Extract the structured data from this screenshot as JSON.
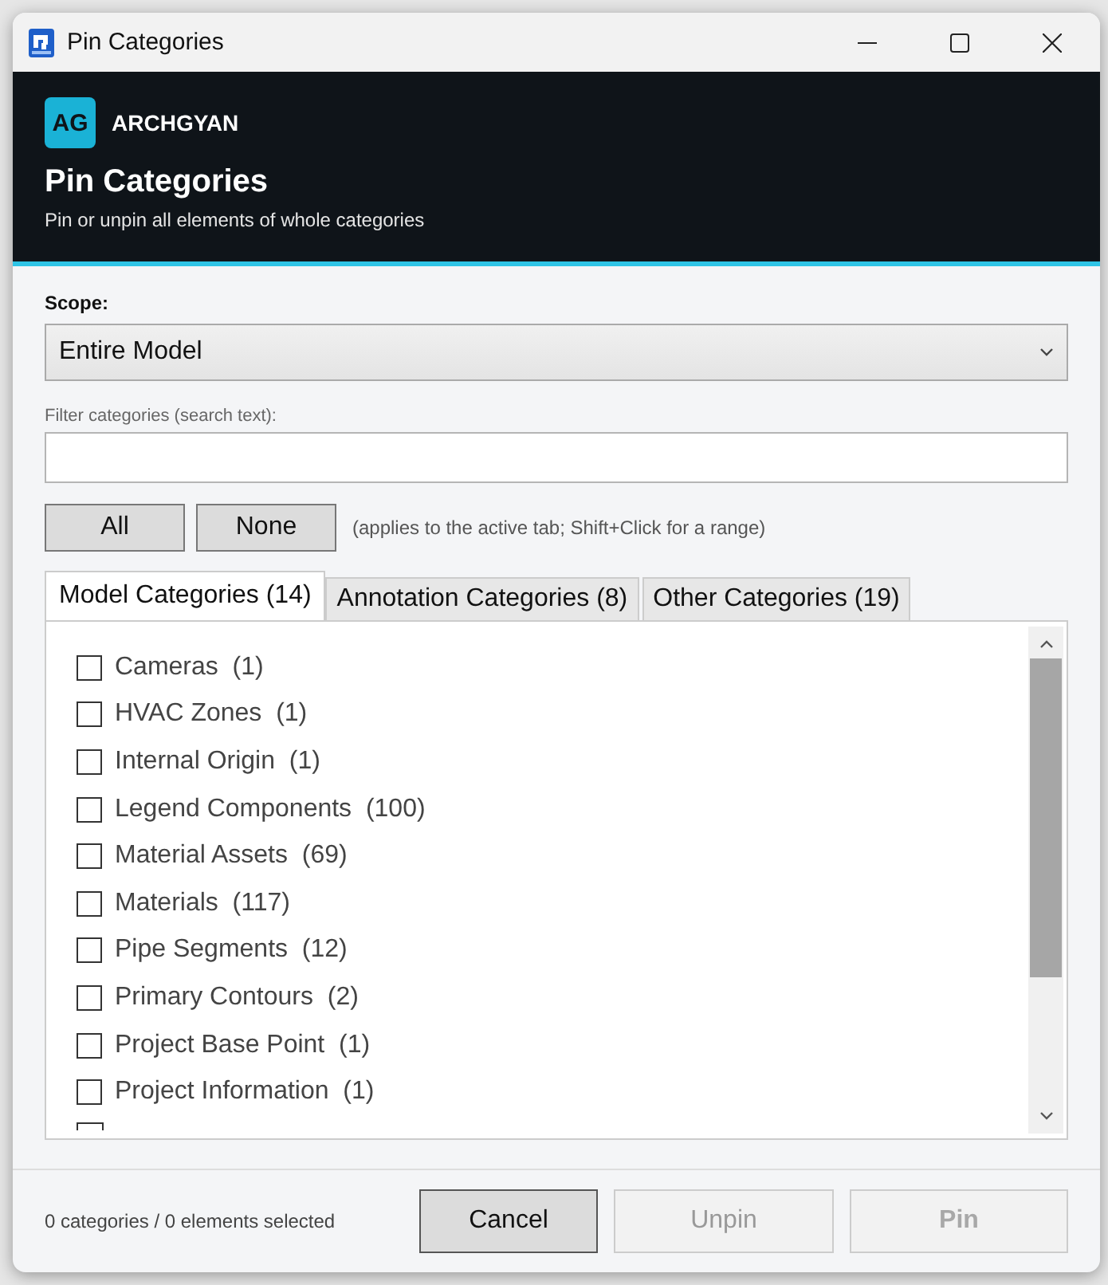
{
  "window": {
    "title": "Pin Categories"
  },
  "header": {
    "logo": "AG",
    "brand": "ARCHGYAN",
    "title": "Pin Categories",
    "subtitle": "Pin or unpin all elements of whole categories"
  },
  "scope": {
    "label": "Scope:",
    "value": "Entire Model"
  },
  "filter": {
    "label": "Filter categories (search text):"
  },
  "select_buttons": [
    "All",
    "None"
  ],
  "hint": "(applies to the active tab; Shift+Click for a range)",
  "tabs": [
    {
      "label": "Model Categories (14)",
      "selected": true
    },
    {
      "label": "Annotation Categories (8)",
      "selected": false
    },
    {
      "label": "Other Categories (19)",
      "selected": false
    }
  ],
  "categories": [
    {
      "name": "Cameras",
      "count": "(1)",
      "checked": false
    },
    {
      "name": "HVAC Zones",
      "count": "(1)",
      "checked": false
    },
    {
      "name": "Internal Origin",
      "count": "(1)",
      "checked": false
    },
    {
      "name": "Legend Components",
      "count": "(100)",
      "checked": false
    },
    {
      "name": "Material Assets",
      "count": "(69)",
      "checked": false
    },
    {
      "name": "Materials",
      "count": "(117)",
      "checked": false
    },
    {
      "name": "Pipe Segments",
      "count": "(12)",
      "checked": false
    },
    {
      "name": "Primary Contours",
      "count": "(2)",
      "checked": false
    },
    {
      "name": "Project Base Point",
      "count": "(1)",
      "checked": false
    },
    {
      "name": "Project Information",
      "count": "(1)",
      "checked": false
    }
  ],
  "status": "0 categories / 0 elements selected",
  "buttons": [
    {
      "label": "Cancel",
      "disabled": false
    },
    {
      "label": "Unpin",
      "disabled": true
    },
    {
      "label": "Pin",
      "disabled": true
    }
  ]
}
